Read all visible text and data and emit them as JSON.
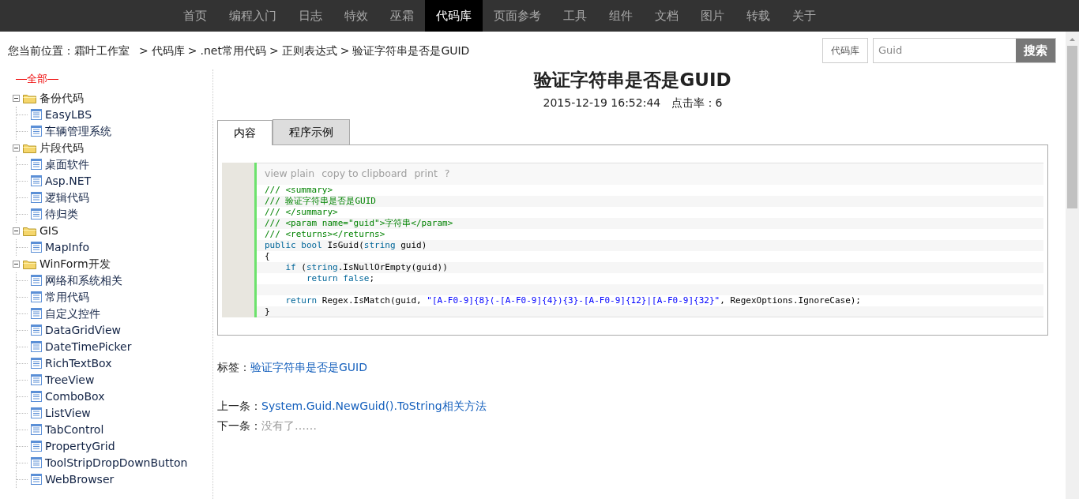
{
  "nav": [
    {
      "label": "首页",
      "selected": false
    },
    {
      "label": "编程入门",
      "selected": false
    },
    {
      "label": "日志",
      "selected": false
    },
    {
      "label": "特效",
      "selected": false
    },
    {
      "label": "巫霜",
      "selected": false
    },
    {
      "label": "代码库",
      "selected": true
    },
    {
      "label": "页面参考",
      "selected": false
    },
    {
      "label": "工具",
      "selected": false
    },
    {
      "label": "组件",
      "selected": false
    },
    {
      "label": "文档",
      "selected": false
    },
    {
      "label": "图片",
      "selected": false
    },
    {
      "label": "转载",
      "selected": false
    },
    {
      "label": "关于",
      "selected": false
    }
  ],
  "breadcrumb": [
    {
      "kind": "label",
      "text": "您当前位置："
    },
    {
      "kind": "link",
      "text": "霜叶工作室"
    },
    {
      "kind": "sep",
      "text": ">"
    },
    {
      "kind": "link",
      "text": "代码库"
    },
    {
      "kind": "sep",
      "text": ">"
    },
    {
      "kind": "link",
      "text": ".net常用代码"
    },
    {
      "kind": "sep",
      "text": ">"
    },
    {
      "kind": "link",
      "text": "正则表达式"
    },
    {
      "kind": "sep",
      "text": ">"
    },
    {
      "kind": "link",
      "text": "验证字符串是否是GUID"
    }
  ],
  "search": {
    "scope": "代码库",
    "value": "Guid",
    "button": "搜索"
  },
  "sidebar": {
    "all": "全部",
    "tree": [
      {
        "label": "备份代码",
        "expanded": true,
        "children": [
          {
            "label": "EasyLBS"
          },
          {
            "label": "车辆管理系统"
          }
        ]
      },
      {
        "label": "片段代码",
        "expanded": true,
        "children": [
          {
            "label": "桌面软件"
          },
          {
            "label": "Asp.NET"
          },
          {
            "label": "逻辑代码"
          },
          {
            "label": "待归类"
          }
        ]
      },
      {
        "label": "GIS",
        "expanded": true,
        "children": [
          {
            "label": "MapInfo"
          }
        ]
      },
      {
        "label": "WinForm开发",
        "expanded": true,
        "children": [
          {
            "label": "网络和系统相关"
          },
          {
            "label": "常用代码"
          },
          {
            "label": "自定义控件"
          },
          {
            "label": "DataGridView"
          },
          {
            "label": "DateTimePicker"
          },
          {
            "label": "RichTextBox"
          },
          {
            "label": "TreeView"
          },
          {
            "label": "ComboBox"
          },
          {
            "label": "ListView"
          },
          {
            "label": "TabControl"
          },
          {
            "label": "PropertyGrid"
          },
          {
            "label": "ToolStripDropDownButton"
          },
          {
            "label": "WebBrowser"
          }
        ]
      }
    ]
  },
  "article": {
    "title": "验证字符串是否是GUID",
    "meta": "2015-12-19 16:52:44   点击率：6",
    "tabs": [
      {
        "label": "内容",
        "selected": true
      },
      {
        "label": "程序示例",
        "selected": false
      }
    ],
    "code_toolbar": [
      "view plain",
      "copy to clipboard",
      "print",
      "?"
    ],
    "code_lines": [
      {
        "kind": "code",
        "tokens": [
          {
            "kind": "comment",
            "text": "/// <summary>"
          }
        ]
      },
      {
        "kind": "code",
        "tokens": [
          {
            "kind": "comment",
            "text": "/// 验证字符串是否是GUID"
          }
        ]
      },
      {
        "kind": "code",
        "tokens": [
          {
            "kind": "comment",
            "text": "/// </summary>"
          }
        ]
      },
      {
        "kind": "code",
        "tokens": [
          {
            "kind": "comment",
            "text": "/// <param name=\"guid\">字符串</param>"
          }
        ]
      },
      {
        "kind": "code",
        "tokens": [
          {
            "kind": "comment",
            "text": "/// <returns></returns>"
          }
        ]
      },
      {
        "kind": "code",
        "tokens": [
          {
            "kind": "keyword",
            "text": "public bool "
          },
          {
            "kind": "plain",
            "text": "IsGuid("
          },
          {
            "kind": "keyword",
            "text": "string"
          },
          {
            "kind": "plain",
            "text": " guid)"
          }
        ]
      },
      {
        "kind": "code",
        "tokens": [
          {
            "kind": "plain",
            "text": "{"
          }
        ]
      },
      {
        "kind": "code",
        "tokens": [
          {
            "kind": "keyword",
            "text": "    if"
          },
          {
            "kind": "plain",
            "text": " ("
          },
          {
            "kind": "keyword",
            "text": "string"
          },
          {
            "kind": "plain",
            "text": ".IsNullOrEmpty(guid))"
          }
        ]
      },
      {
        "kind": "code",
        "tokens": [
          {
            "kind": "keyword",
            "text": "        return false"
          },
          {
            "kind": "plain",
            "text": ";"
          }
        ]
      },
      {
        "kind": "blank"
      },
      {
        "kind": "code",
        "tokens": [
          {
            "kind": "keyword",
            "text": "    return"
          },
          {
            "kind": "plain",
            "text": " Regex.IsMatch(guid, "
          },
          {
            "kind": "string",
            "text": "\"[A-F0-9]{8}(-[A-F0-9]{4}){3}-[A-F0-9]{12}|[A-F0-9]{32}\""
          },
          {
            "kind": "plain",
            "text": ", RegexOptions.IgnoreCase);"
          }
        ]
      },
      {
        "kind": "code",
        "tokens": [
          {
            "kind": "plain",
            "text": "}"
          }
        ]
      }
    ],
    "tags_label": "标签：",
    "tags": [
      "验证字符串是否是GUID"
    ],
    "prev_label": "上一条：",
    "prev": "System.Guid.NewGuid().ToString相关方法",
    "next_label": "下一条：",
    "next": "没有了……"
  }
}
